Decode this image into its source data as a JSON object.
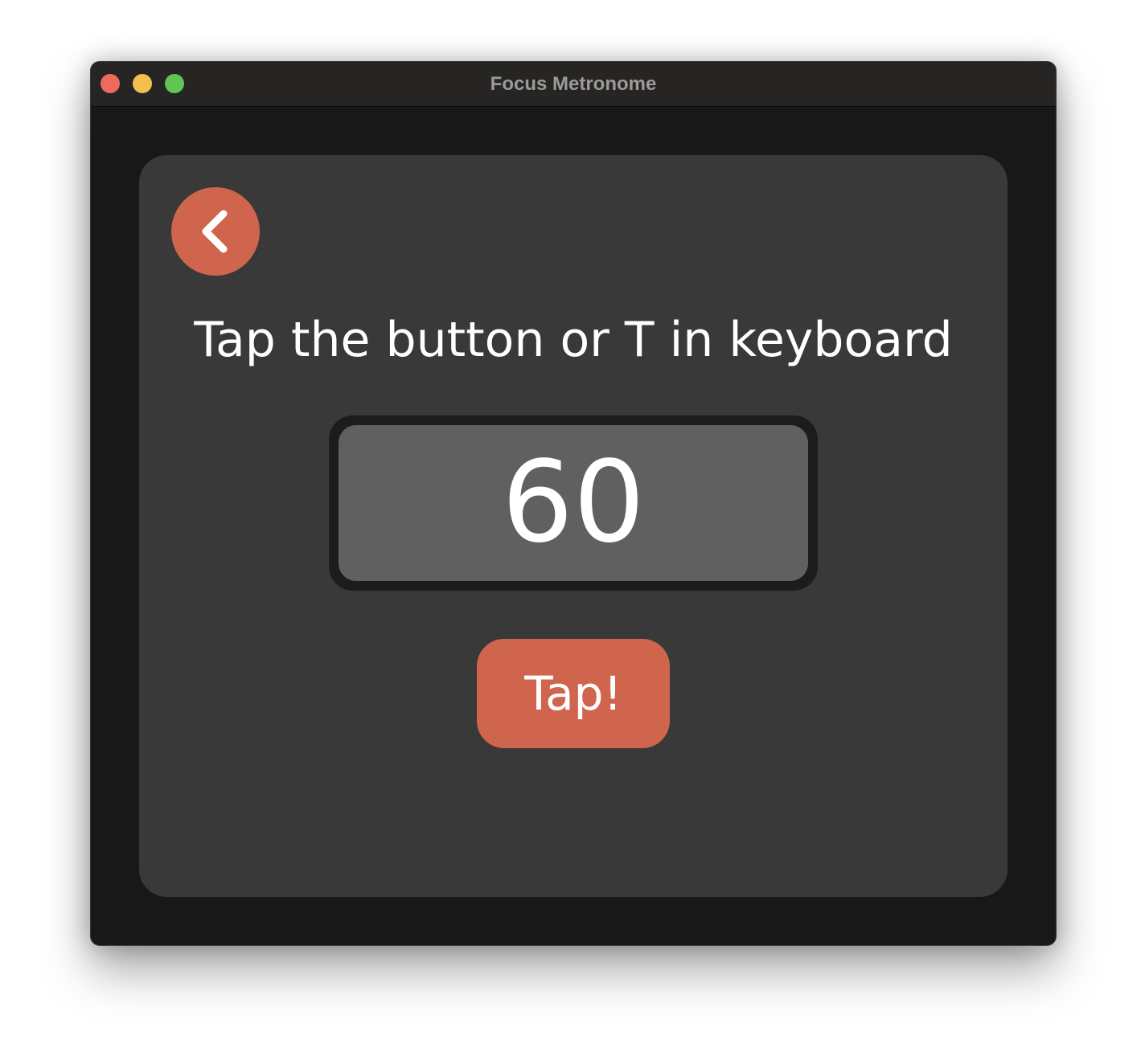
{
  "window": {
    "title": "Focus Metronome",
    "controls": {
      "close_color": "#ed6a5e",
      "minimize_color": "#f5bf4f",
      "zoom_color": "#61c554"
    }
  },
  "main": {
    "back_icon": "chevron-left-icon",
    "instruction": "Tap the button or T in keyboard",
    "bpm_value": "60",
    "tap_label": "Tap!"
  },
  "colors": {
    "accent": "#d0654e",
    "panel": "#393939",
    "background": "#181818",
    "display": "#606060"
  }
}
